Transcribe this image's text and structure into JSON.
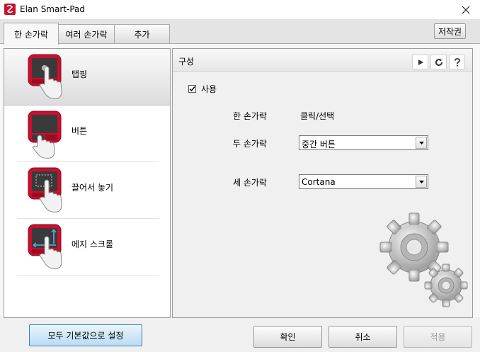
{
  "window": {
    "title": "Elan Smart-Pad"
  },
  "tabs": [
    {
      "label": "한 손가락",
      "active": true
    },
    {
      "label": "여러 손가락",
      "active": false
    },
    {
      "label": "추가",
      "active": false
    }
  ],
  "copyright_label": "저작권",
  "features": [
    {
      "label": "탭핑",
      "icon": "tap-icon",
      "selected": true
    },
    {
      "label": "버튼",
      "icon": "button-icon",
      "selected": false
    },
    {
      "label": "끌어서 놓기",
      "icon": "drag-drop-icon",
      "selected": false
    },
    {
      "label": "에지 스크롤",
      "icon": "edge-scroll-icon",
      "selected": false
    }
  ],
  "config": {
    "title": "구성",
    "enable_label": "사용",
    "enabled": true,
    "one_finger": {
      "label": "한 손가락",
      "value": "클릭/선택"
    },
    "two_finger": {
      "label": "두 손가락",
      "value": "중간 버튼"
    },
    "three_finger": {
      "label": "세 손가락",
      "value": "Cortana"
    }
  },
  "buttons": {
    "reset_defaults": "모두 기본값으로 설정",
    "ok": "확인",
    "cancel": "취소",
    "apply": "적용"
  },
  "colors": {
    "accent": "#c8102e",
    "primary_button": "#b8dcf5"
  }
}
